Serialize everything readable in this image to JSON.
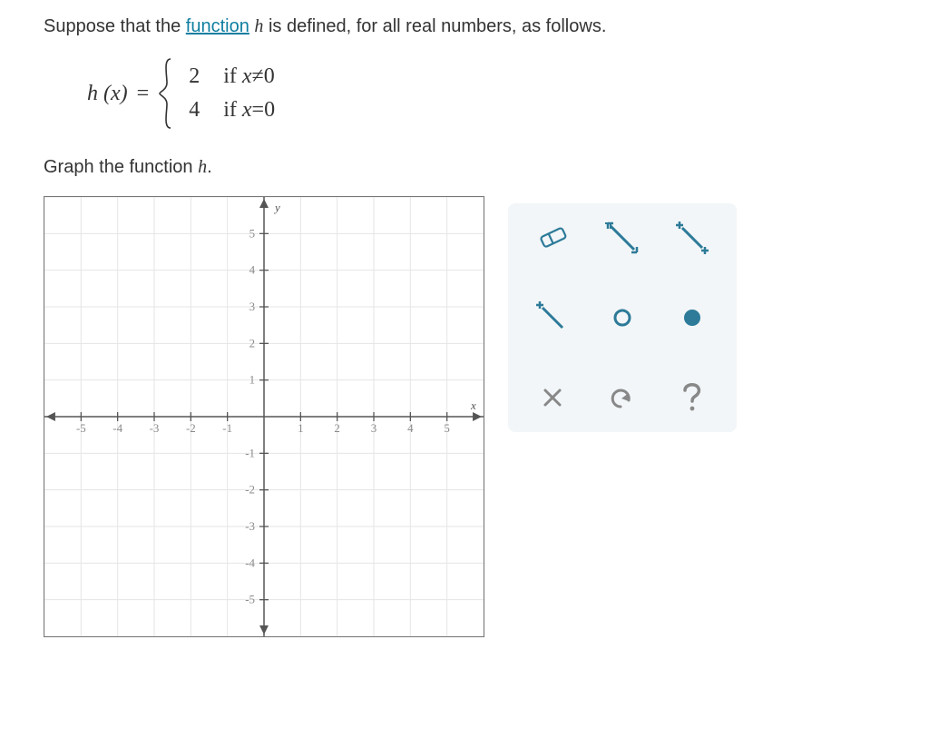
{
  "intro": {
    "pre": "Suppose that the ",
    "link": "function",
    "post_1": " ",
    "var": "h",
    "post_2": " is defined, for all real numbers, as follows."
  },
  "piecewise": {
    "lhs_h": "h",
    "lhs_x": "x",
    "eq": "=",
    "cases": [
      {
        "value": "2",
        "cond_pre": "if ",
        "cond_var": "x",
        "cond_rel": "≠",
        "cond_rhs": "0"
      },
      {
        "value": "4",
        "cond_pre": "if ",
        "cond_var": "x",
        "cond_rel": "=",
        "cond_rhs": "0"
      }
    ]
  },
  "instruction": {
    "pre": "Graph the function ",
    "var": "h",
    "post": "."
  },
  "chart_data": {
    "type": "scatter",
    "title": "",
    "xlabel": "x",
    "ylabel": "y",
    "xlim": [
      -6,
      6
    ],
    "ylim": [
      -6,
      6
    ],
    "xticks": [
      -5,
      -4,
      -3,
      -2,
      -1,
      1,
      2,
      3,
      4,
      5
    ],
    "yticks": [
      -5,
      -4,
      -3,
      -2,
      -1,
      1,
      2,
      3,
      4,
      5
    ],
    "series": []
  },
  "palette": {
    "tools": [
      {
        "name": "eraser-tool"
      },
      {
        "name": "segment-both-ends-tool"
      },
      {
        "name": "segment-plus-ends-tool"
      },
      {
        "name": "ray-tool"
      },
      {
        "name": "open-point-tool"
      },
      {
        "name": "closed-point-tool"
      }
    ],
    "actions": [
      {
        "name": "clear",
        "glyph": "✕"
      },
      {
        "name": "undo",
        "glyph": "↶"
      },
      {
        "name": "help",
        "glyph": "?"
      }
    ]
  }
}
